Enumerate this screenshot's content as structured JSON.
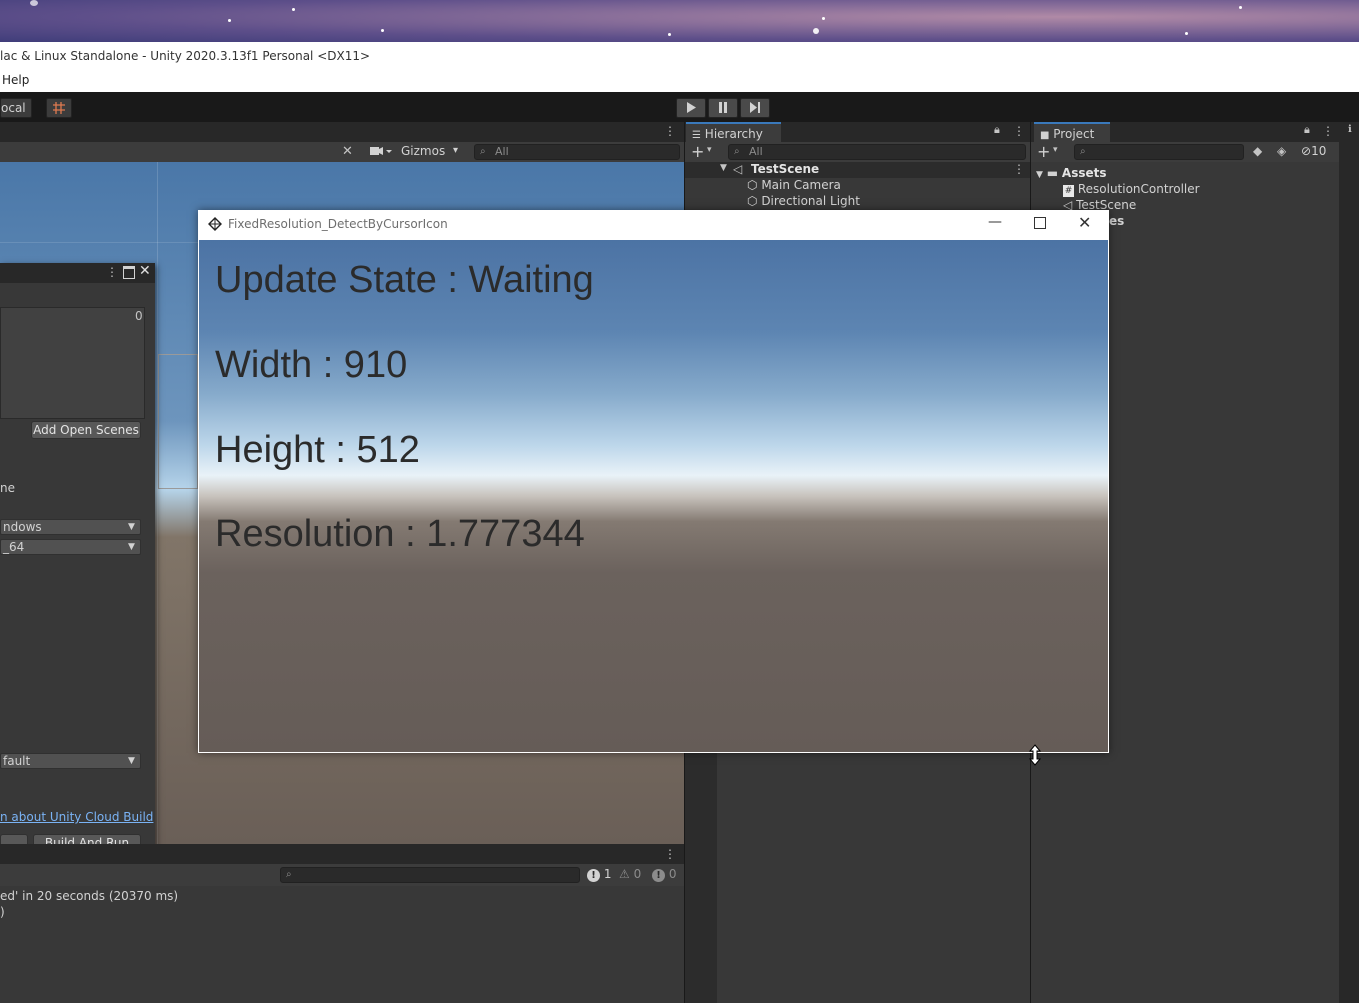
{
  "window": {
    "title": "lac & Linux Standalone - Unity 2020.3.13f1 Personal <DX11>",
    "menu_help": "Help"
  },
  "toolbar": {
    "local_label": "ocal",
    "play_icon": "play-icon",
    "pause_icon": "pause-icon",
    "step_icon": "step-icon"
  },
  "scene_toolbar": {
    "gizmos_label": "Gizmos",
    "search_placeholder": "All"
  },
  "hierarchy": {
    "tab_label": "Hierarchy",
    "search_placeholder": "All",
    "scene_name": "TestScene",
    "items": [
      "Main Camera",
      "Directional Light"
    ]
  },
  "project": {
    "tab_label": "Project",
    "hidden_count": "10",
    "root": "Assets",
    "items": [
      "ResolutionController",
      "TestScene",
      "es"
    ]
  },
  "build_settings": {
    "scene_count": "0",
    "add_open_scenes": "Add Open Scenes",
    "platform_label": "ne",
    "target_platform": "ndows",
    "architecture": "_64",
    "compression": "fault",
    "cloud_build_link": "n about Unity Cloud Build",
    "build_and_run": "Build And Run"
  },
  "console": {
    "errors": "1",
    "warnings": "0",
    "infos": "0",
    "line1": "ed' in 20 seconds (20370 ms)",
    "line2": ")"
  },
  "game_window": {
    "title": "FixedResolution_DetectByCursorIcon",
    "update_state": "Update State : Waiting",
    "width": "Width : 910",
    "height": "Height : 512",
    "resolution": "Resolution : 1.777344"
  },
  "colors": {
    "accent": "#3a79bb",
    "panel": "#383838",
    "link": "#7ab3f5"
  }
}
